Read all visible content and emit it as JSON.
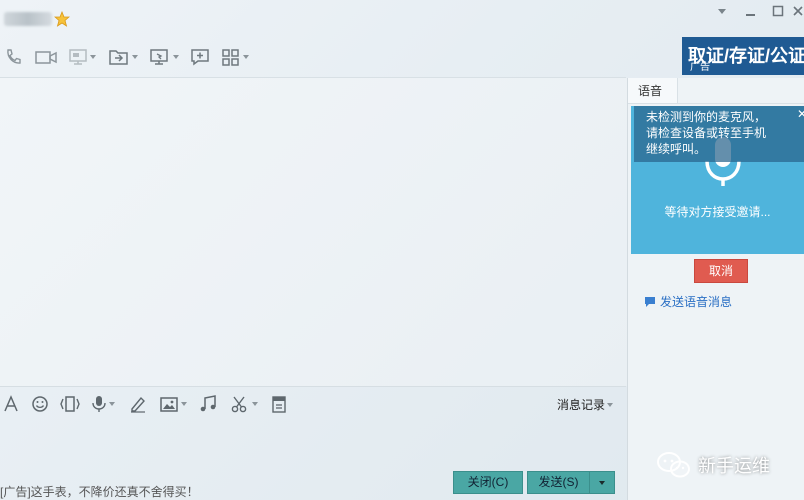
{
  "titlebar": {
    "contact_name": "",
    "controls": [
      "minimize-icon",
      "maximize-icon",
      "close-icon"
    ]
  },
  "toolbar": {
    "icons": [
      "phone-icon",
      "video-icon",
      "screen-share-icon",
      "file-transfer-icon",
      "remote-desktop-icon",
      "add-chat-icon",
      "apps-icon"
    ]
  },
  "ad_banner": {
    "text": "取证/存证/公证",
    "tag": "广告"
  },
  "right_panel": {
    "tab_label": "语音",
    "warning": {
      "line1": "未检测到你的麦克风，",
      "line2": "请检查设备或转至手机",
      "line3": "继续呼叫。"
    },
    "waiting_text": "等待对方接受邀请...",
    "cancel_label": "取消",
    "send_voice_label": "发送语音消息"
  },
  "input_toolbar": {
    "icons": [
      "font-icon",
      "emoji-icon",
      "shake-icon",
      "voice-icon",
      "handwriting-icon",
      "image-icon",
      "music-icon",
      "screenshot-icon",
      "clipboard-icon"
    ],
    "history_label": "消息记录"
  },
  "footer": {
    "ad_text": "[广告]这手表，不降价还真不舍得买！",
    "close_label": "关闭(C)",
    "send_label": "发送(S)"
  },
  "watermark": {
    "text": "新手运维"
  },
  "colors": {
    "banner": "#1f5a93",
    "voice_bg": "#4fb4dc",
    "cancel": "#e05b50",
    "button": "#4aa7a4",
    "link": "#2a6fc4"
  }
}
